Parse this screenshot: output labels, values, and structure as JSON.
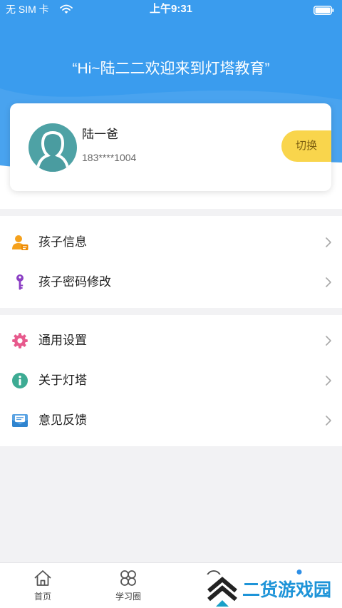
{
  "status_bar": {
    "carrier": "无 SIM 卡",
    "time": "上午9:31",
    "icons": [
      "wifi-icon",
      "battery-icon"
    ]
  },
  "header": {
    "greeting": "“Hi~陆二二欢迎来到灯塔教育”"
  },
  "profile": {
    "avatar_icon": "person-avatar-icon",
    "name": "陆一爸",
    "phone": "183****1004",
    "switch_label": "切换"
  },
  "menu": {
    "sections": [
      {
        "items": [
          {
            "label": "孩子信息",
            "icon": "child-info-icon"
          },
          {
            "label": "孩子密码修改",
            "icon": "key-icon"
          }
        ]
      },
      {
        "items": [
          {
            "label": "通用设置",
            "icon": "gear-icon"
          },
          {
            "label": "关于灯塔",
            "icon": "info-icon"
          },
          {
            "label": "意见反馈",
            "icon": "mail-icon"
          }
        ]
      }
    ]
  },
  "tab_bar": {
    "tabs": [
      {
        "label": "首页",
        "icon": "home-icon"
      },
      {
        "label": "学习圈",
        "icon": "clover-icon"
      }
    ]
  },
  "watermark": {
    "text": "二货游戏园",
    "icon": "chevron-stack-logo-icon"
  },
  "colors": {
    "header_blue": "#3a9cee",
    "switch_yellow": "#f9d54c",
    "avatar_teal": "#4ea2a5",
    "watermark_blue": "#1e94d8"
  }
}
